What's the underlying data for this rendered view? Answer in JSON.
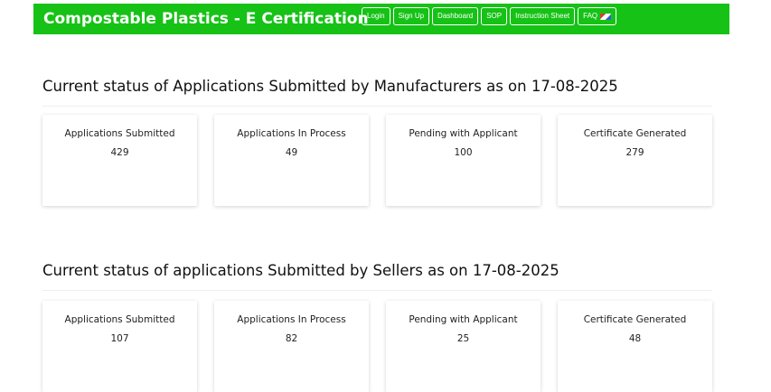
{
  "header": {
    "title": "Compostable Plastics - E Certification",
    "bg_color": "#16c216",
    "nav": [
      {
        "label": "Login"
      },
      {
        "label": "Sign Up"
      },
      {
        "label": "Dashboard"
      },
      {
        "label": "SOP"
      },
      {
        "label": "Instruction Sheet"
      },
      {
        "label": "FAQ",
        "icon": "flag-icon"
      }
    ]
  },
  "manufacturers": {
    "title": "Current status of Applications Submitted by Manufacturers as on 17-08-2025",
    "cards": [
      {
        "label": "Applications Submitted",
        "value": "429"
      },
      {
        "label": "Applications In Process",
        "value": "49"
      },
      {
        "label": "Pending with Applicant",
        "value": "100"
      },
      {
        "label": "Certificate Generated",
        "value": "279"
      }
    ]
  },
  "sellers": {
    "title": "Current status of applications Submitted by Sellers as on 17-08-2025",
    "cards": [
      {
        "label": "Applications Submitted",
        "value": "107"
      },
      {
        "label": "Applications In Process",
        "value": "82"
      },
      {
        "label": "Pending with Applicant",
        "value": "25"
      },
      {
        "label": "Certificate Generated",
        "value": "48"
      }
    ]
  }
}
